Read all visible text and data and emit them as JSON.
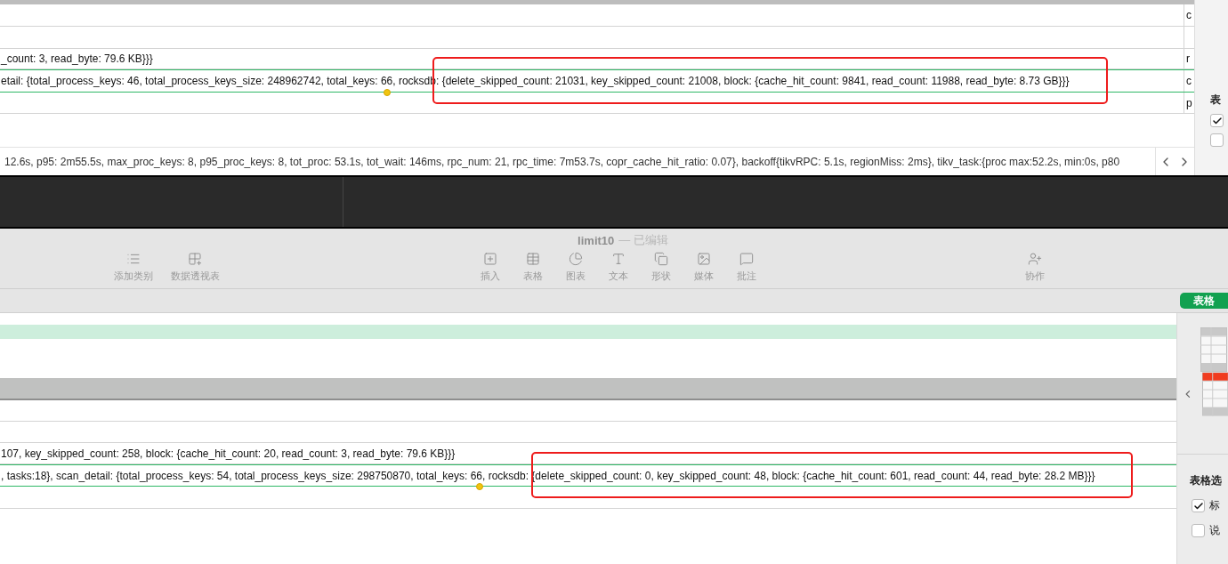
{
  "top_window": {
    "rows": [
      {
        "text": "",
        "side": "c",
        "selected": false,
        "highlighted": false
      },
      {
        "text": "",
        "side": "",
        "selected": false,
        "highlighted": false
      },
      {
        "text": "_count: 3, read_byte: 79.6 KB}}}",
        "side": "r",
        "selected": false,
        "highlighted": false
      },
      {
        "text": "etail: {total_process_keys: 46, total_process_keys_size: 248962742, total_keys: 66, rocksdb: {delete_skipped_count: 21031, key_skipped_count: 21008, block: {cache_hit_count: 9841, read_count: 11988, read_byte: 8.73 GB}}}",
        "side": "c",
        "selected": true,
        "highlighted": true
      },
      {
        "text": "",
        "side": "p",
        "selected": false,
        "highlighted": false
      }
    ],
    "status_text": "12.6s, p95: 2m55.5s, max_proc_keys: 8, p95_proc_keys: 8, tot_proc: 53.1s, tot_wait: 146ms, rpc_num: 21, rpc_time: 7m53.7s, copr_cache_hit_ratio: 0.07}, backoff{tikvRPC: 5.1s, regionMiss: 2ms}, tikv_task:{proc max:52.2s, min:0s, p80",
    "sidebar": {
      "heading": "表",
      "options": [
        {
          "checked": true
        },
        {
          "checked": false
        }
      ]
    }
  },
  "bottom_window": {
    "title": "limit10",
    "status": "— 已编辑",
    "toolbar": [
      {
        "label": "添加类别"
      },
      {
        "label": "数据透视表"
      },
      {
        "label": "插入"
      },
      {
        "label": "表格"
      },
      {
        "label": "图表"
      },
      {
        "label": "文本"
      },
      {
        "label": "形状"
      },
      {
        "label": "媒体"
      },
      {
        "label": "批注"
      },
      {
        "label": "协作"
      }
    ],
    "format_tab": {
      "label": "表格",
      "selected": true
    },
    "rows": [
      {
        "text": "",
        "selected": false,
        "highlighted": false
      },
      {
        "text": "",
        "selected": false,
        "highlighted": false
      },
      {
        "text": "107, key_skipped_count: 258, block: {cache_hit_count: 20, read_count: 3, read_byte: 79.6 KB}}}",
        "selected": false,
        "highlighted": false
      },
      {
        "text": ", tasks:18}, scan_detail: {total_process_keys: 54, total_process_keys_size: 298750870, total_keys: 66, rocksdb: {delete_skipped_count: 0, key_skipped_count: 48, block: {cache_hit_count: 601, read_count: 44, read_byte: 28.2 MB}}}",
        "selected": true,
        "highlighted": true
      },
      {
        "text": "",
        "selected": false,
        "highlighted": false
      }
    ],
    "sidebar": {
      "heading": "表格选",
      "options": [
        {
          "label": "标",
          "checked": true
        },
        {
          "label": "说",
          "checked": false
        }
      ]
    }
  }
}
